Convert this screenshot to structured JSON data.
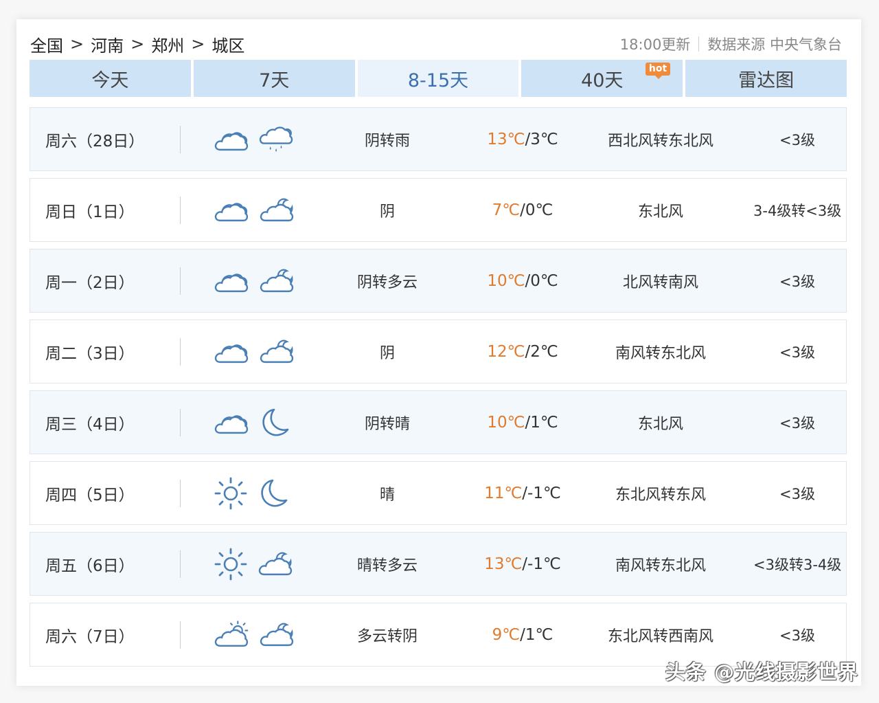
{
  "breadcrumb": [
    "全国",
    "河南",
    "郑州",
    "城区"
  ],
  "breadcrumb_sep": ">",
  "meta": {
    "update": "18:00更新",
    "source": "数据来源 中央气象台"
  },
  "tabs": [
    {
      "label": "今天",
      "active": false
    },
    {
      "label": "7天",
      "active": false
    },
    {
      "label": "8-15天",
      "active": true
    },
    {
      "label": "40天",
      "active": false,
      "badge": "hot"
    },
    {
      "label": "雷达图",
      "active": false
    }
  ],
  "rows": [
    {
      "day": "周六（28日）",
      "icons": [
        "cloud",
        "cloud-rain"
      ],
      "cond": "阴转雨",
      "hi": "13℃",
      "lo": "3℃",
      "wind": "西北风转东北风",
      "level": "<3级"
    },
    {
      "day": "周日（1日）",
      "icons": [
        "cloud",
        "cloud-moon"
      ],
      "cond": "阴",
      "hi": "7℃",
      "lo": "0℃",
      "wind": "东北风",
      "level": "3-4级转<3级"
    },
    {
      "day": "周一（2日）",
      "icons": [
        "cloud",
        "cloud-moon"
      ],
      "cond": "阴转多云",
      "hi": "10℃",
      "lo": "0℃",
      "wind": "北风转南风",
      "level": "<3级"
    },
    {
      "day": "周二（3日）",
      "icons": [
        "cloud",
        "cloud-moon"
      ],
      "cond": "阴",
      "hi": "12℃",
      "lo": "2℃",
      "wind": "南风转东北风",
      "level": "<3级"
    },
    {
      "day": "周三（4日）",
      "icons": [
        "cloud",
        "moon"
      ],
      "cond": "阴转晴",
      "hi": "10℃",
      "lo": "1℃",
      "wind": "东北风",
      "level": "<3级"
    },
    {
      "day": "周四（5日）",
      "icons": [
        "sun",
        "moon"
      ],
      "cond": "晴",
      "hi": "11℃",
      "lo": "-1℃",
      "wind": "东北风转东风",
      "level": "<3级"
    },
    {
      "day": "周五（6日）",
      "icons": [
        "sun",
        "cloud-moon"
      ],
      "cond": "晴转多云",
      "hi": "13℃",
      "lo": "-1℃",
      "wind": "南风转东北风",
      "level": "<3级转3-4级"
    },
    {
      "day": "周六（7日）",
      "icons": [
        "cloud-sun",
        "cloud-moon"
      ],
      "cond": "多云转阴",
      "hi": "9℃",
      "lo": "1℃",
      "wind": "东北风转西南风",
      "level": "<3级"
    }
  ],
  "colors": {
    "high_temp": "#e07b2e",
    "tab_bg": "#cfe3f6",
    "tab_active_bg": "#eaf3fc",
    "tab_active_text": "#3a6fb0",
    "icon_stroke": "#4a7fb5",
    "hot_badge": "#f08a3c"
  },
  "watermark": "头条 @光线摄影世界"
}
